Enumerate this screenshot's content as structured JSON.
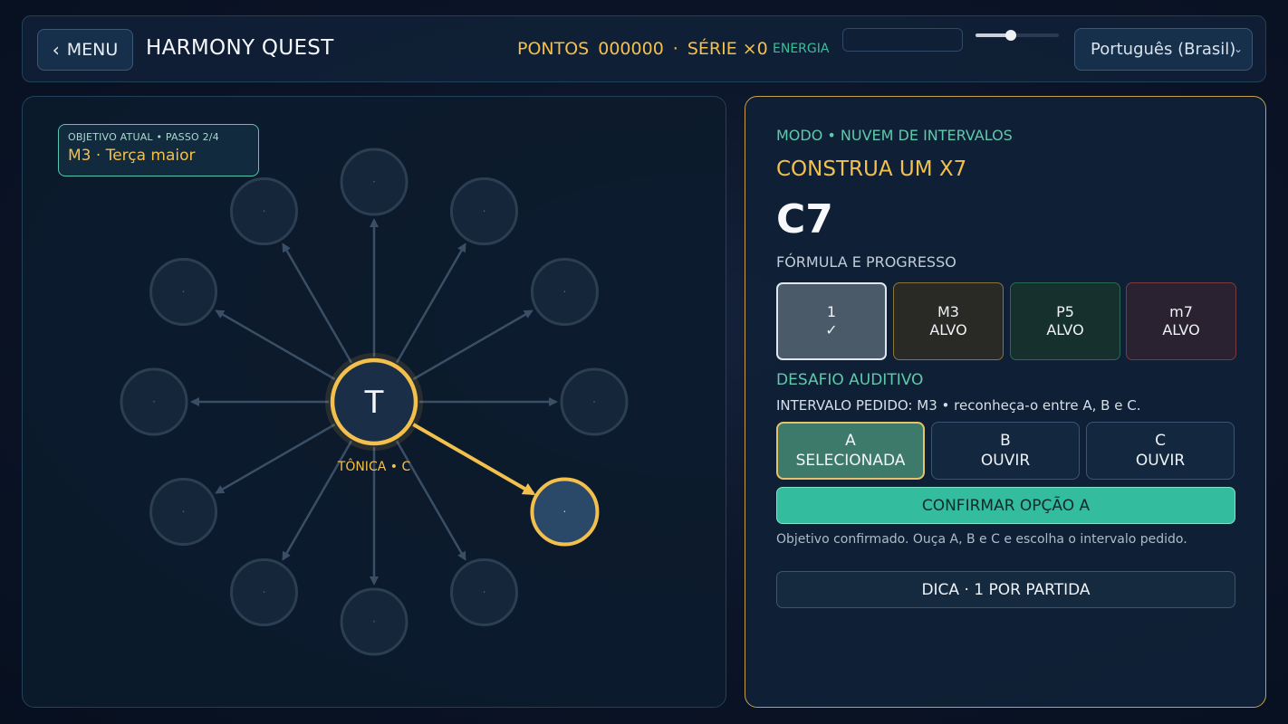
{
  "header": {
    "menu_label": "MENU",
    "title": "HARMONY QUEST",
    "points_label": "PONTOS",
    "points_value": "000000",
    "separator": "·",
    "streak_label": "SÉRIE ×0",
    "energy_label": "ENERGIA",
    "energy_fraction": 0,
    "volume_fraction": 0.42,
    "language_selected": "Português (Brasil)"
  },
  "board": {
    "objective_top": "OBJETIVO ATUAL  •  PASSO 2/4",
    "objective_main": "M3  ·  Terça maior",
    "root_symbol": "T",
    "root_label": "TÔNICA • C",
    "node_dot": "·",
    "node_count": 12,
    "active_node_index": 4
  },
  "panel": {
    "mode": "MODO • NUVEM DE INTERVALOS",
    "task": "CONSTRUA UM X7",
    "chord": "C7",
    "formula_title": "FÓRMULA E PROGRESSO",
    "formula": [
      {
        "label": "1",
        "state": "✓"
      },
      {
        "label": "M3",
        "state": "ALVO"
      },
      {
        "label": "P5",
        "state": "ALVO"
      },
      {
        "label": "m7",
        "state": "ALVO"
      }
    ],
    "aural_title": "DESAFIO AUDITIVO",
    "aural_prompt": "INTERVALO PEDIDO: M3 • reconheça-o entre A, B e C.",
    "options": [
      {
        "letter": "A",
        "action": "SELECIONADA"
      },
      {
        "letter": "B",
        "action": "OUVIR"
      },
      {
        "letter": "C",
        "action": "OUVIR"
      }
    ],
    "confirm_label": "CONFIRMAR OPÇÃO A",
    "status_text": "Objetivo confirmado. Ouça A, B e C e escolha o intervalo pedido.",
    "hint_label": "DICA · 1 POR PARTIDA"
  },
  "colors": {
    "accent_gold": "#f3c04d",
    "accent_teal": "#34bc9e",
    "background": "#0b1427"
  }
}
